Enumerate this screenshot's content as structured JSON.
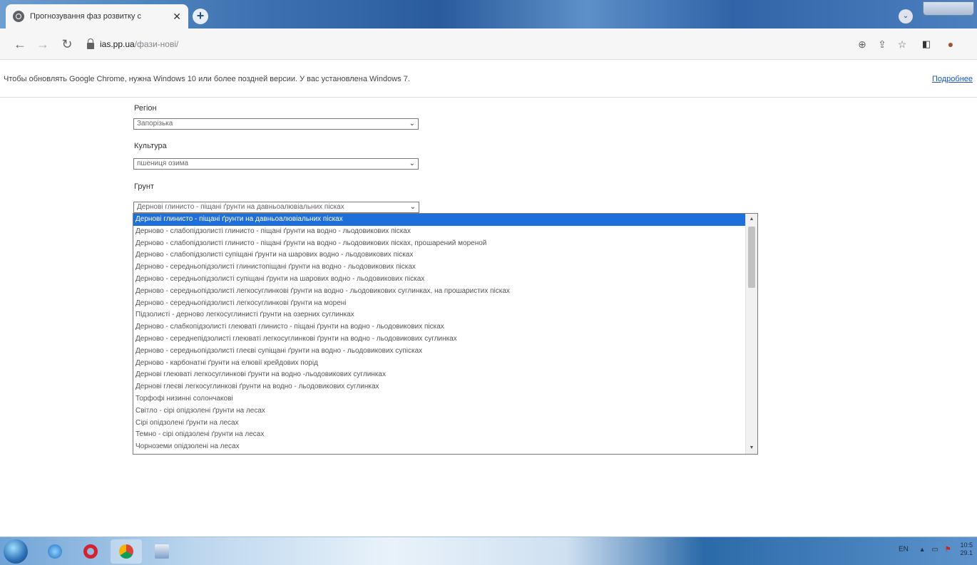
{
  "browser": {
    "tab_title": "Прогнозування фаз розвитку с",
    "tab_close": "✕",
    "new_tab": "+",
    "url_host": "ias.pp.ua",
    "url_path": "/фази-нові/"
  },
  "infobar": {
    "message": "Чтобы обновлять Google Chrome, нужна Windows 10 или более поздней версии. У вас установлена Windows 7.",
    "link": "Подробнее"
  },
  "form": {
    "region_label": "Регіон",
    "region_value": "Запорізька",
    "culture_label": "Культура",
    "culture_value": "пшениця озима",
    "soil_label": "Грунт",
    "soil_value": "Дернові глинисто - піщані ґрунти на давньоалювіальних пісках",
    "soil_options": [
      "Дернові глинисто - піщані ґрунти на давньоалювіальних пісках",
      "Дерново - слабопідзолисті глинисто - піщані ґрунти на водно - льодовикових пісках",
      "Дерново - слабопідзолисті глинисто - піщані ґрунти на водно - льодовикових пісках, прошарений мореной",
      "Дерново - слабопідзолисті супіщані ґрунти на шарових водно - льодовикових пісках",
      "Дерново - середньопідзолисті глинистопіщані ґрунти на водно - льодовикових пісках",
      "Дерново - середньопідзолисті супіщані ґрунти на шарових водно - льодовикових пісках",
      "Дерново - середньопідзолисті легкосуглинкові ґрунти на водно - льодовикових суглинках, на прошаристих пісках",
      "Дерново - середньопідзолисті легкосуглинкові ґрунти на морені",
      "Підзолисті - дерново легкосуглинисті ґрунти на озерних суглинках",
      "Дерново - слабкопідзолисті глеюваті глинисто - піщані ґрунти на водно - льодовикових пісках",
      "Дерново - середнепідзолисті глеюваті легкосуглинкові ґрунти на водно - льодовикових суглинках",
      "Дерново - середньопідзолисті глеєві супіщані ґрунти на водно - льодовикових супісках",
      "Дерново - карбонатні ґрунти на елювії крейдових порід",
      "Дернові глеюваті легкосуглинкові ґрунти на водно -льодовикових суглинках",
      "Дернові глеєві легкосуглинкові ґрунти на водно - льодовикових суглинках",
      "Торфофі низинні солончакові",
      "Світло - сірі опідзолені ґрунти на лесах",
      "Сірі опідзолені ґрунти на лесах",
      "Темно - сірі опідзолені ґрунти на лесах",
      "Чорноземи опідзолені на лесах"
    ]
  },
  "taskbar": {
    "lang": "EN",
    "time": "10:5",
    "date": "29.1"
  },
  "colors": {
    "selected_option": "#1e6fd9",
    "link": "#1a55c9"
  }
}
